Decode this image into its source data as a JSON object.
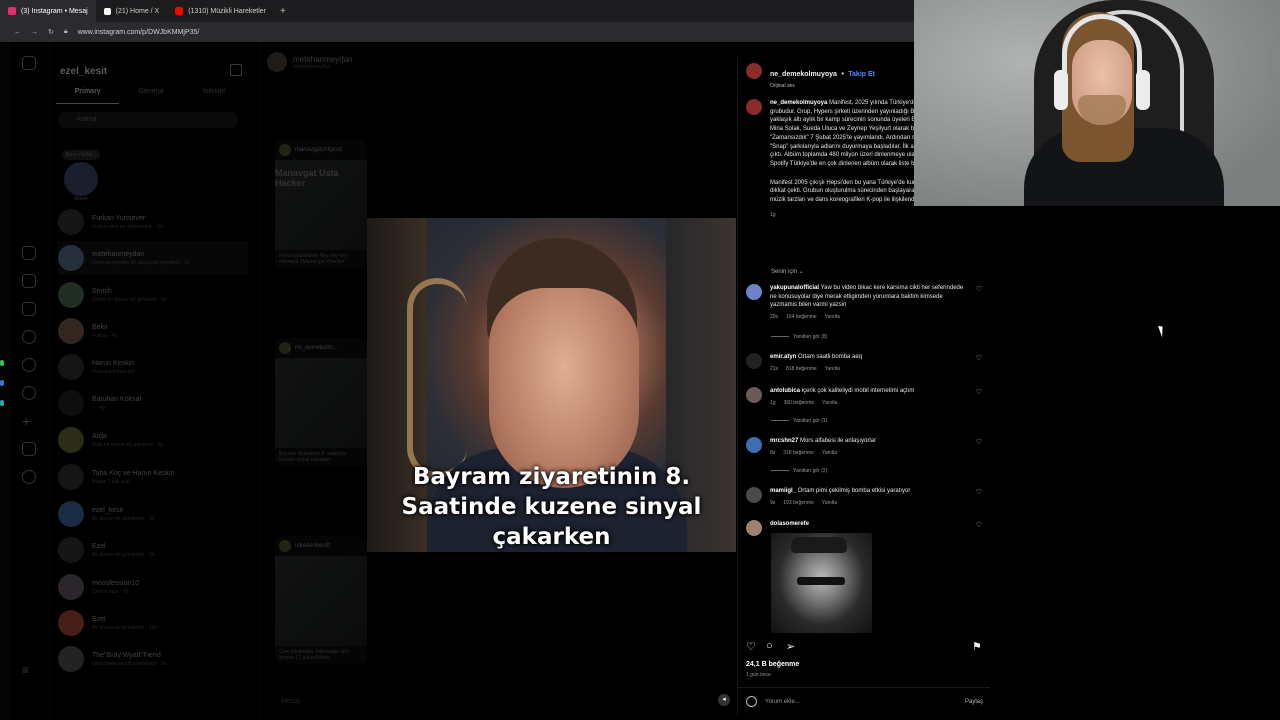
{
  "browser": {
    "tabs": [
      {
        "label": "(3) Instagram • Mesaj",
        "color": "#e1306c"
      },
      {
        "label": "(21) Home / X",
        "color": "#ffffff"
      },
      {
        "label": "(1310) Müzikli Hareketler",
        "color": "#ff0000"
      }
    ],
    "new_tab": "+",
    "url": "www.instagram.com/p/DWJbKMMjP35/"
  },
  "dm": {
    "username": "ezel_kesit",
    "tabs": [
      "Primary",
      "General",
      "İstekler"
    ],
    "search_placeholder": "Arama",
    "note": {
      "bubble": "Bizim Notlar...",
      "label": "Notun"
    },
    "conversations": [
      {
        "name": "Furkan Yurtsever",
        "sub": "Furkan sent an attachment. · 5d"
      },
      {
        "name": "metehanmeydan",
        "sub": "metehanmeydan bir dosya ekl gönderdi · 1s"
      },
      {
        "name": "Semih",
        "sub": "Semih bir dosya eki gönderdi · 3s"
      },
      {
        "name": "Bekir",
        "sub": "Furkan · 4s"
      },
      {
        "name": "Harun Keskin",
        "sub": "Furkan'a mesaj attı"
      },
      {
        "name": "Batuhan Köksal",
        "sub": "7 · 4g"
      },
      {
        "name": "Arda",
        "sub": "Arda bir dosya eki gönderdi · 4g"
      },
      {
        "name": "Taha Koç ve Harun Keskin",
        "sub": "Bugün 2 kişi aktif"
      },
      {
        "name": "ezel_kesit",
        "sub": "Bir dosya eki gönderdin · 1h"
      },
      {
        "name": "Ezel",
        "sub": "Bir dosya eki gönderdin · 1h"
      },
      {
        "name": "meosfession10",
        "sub": "Cem'in burs · 1h"
      },
      {
        "name": "Ezel",
        "sub": "Bir dosya eki gönderdin · 13h"
      },
      {
        "name": "The\"Bray Wyatt\"Fiend",
        "sub": "https://www.reddit.com/r/post · 1h"
      }
    ],
    "chat": {
      "name": "metehanmeydan",
      "handle": "metehanmeydan",
      "cards": [
        {
          "user": "manavgatshitpost",
          "caption": "manavgatshitpost Ney ney ney #Antalya #Manavgat #Hacker"
        },
        {
          "user": "ne_demekolm...",
          "caption": "Bayram ziyaretinin 8. saatinde kuzene sinyal çakarken"
        },
        {
          "user": "ulkedenkesitt",
          "caption": "Cem bilekbokta Teknosada alici iphone 17 güncelleken"
        }
      ],
      "title": "Manavgat Usta Hacker",
      "input_placeholder": "Mesaj..."
    }
  },
  "video": {
    "caption_lines": [
      "Bayram ziyaretinin 8.",
      "Saatinde kuzene sinyal",
      "çakarken"
    ],
    "mute_icon": "speaker-muted-icon"
  },
  "post": {
    "author": "ne_demekolmuyoya",
    "follow": "Takip Et",
    "audio": "Orijinal ses",
    "description_p1": "Manifest, 2025 yılında Türkiye'de kurulan altı üyeli bir kız grubudur. Grup, Hypers şirketi üzerinden yayınladığı BIG 5 Türkiye programı ile yaklaşık altı aylık bir kamp sürecinin sonunda üyeleri Esin Bayram, Lidya Pınar, Mina Solak, Sueda Uluca ve Zeynep Yeşilyurt olarak belirlendi. İlk teklileri \"Zamansızdık\" 7 Şubat 2025'te yayımlandı. Ardından sırayla \"Arıyo\", \"KTS\" ve \"Snap\" şarkılarıyla adlarını duyurmaya başladılar. İlk albümleri \"Manifest\" 2025'te çıktı. Albüm toplamda 480 milyon üzeri dinlenmeye ulaştı. Çıktığı tarihten bu yana Spotify Türkiye'de en çok dinlenen albüm olarak liste başıdır.",
    "description_p2": "Manifest 2005 çıkışlı Hepsi'den bu yana Türkiye'de kurulan ilk kız grubu olarak dikkat çekti. Grubun oluşturulma sürecinden başlayarak sosyal medya içerikleri, müzik tarzları ve dans koreografileri K-pop ile ilişkilendirildi.",
    "time": "1g",
    "for_you": "Senin için ⌄",
    "comments": [
      {
        "user": "yakupunalofficial",
        "text": "Yaw bu video bikac kere karsima cikti her seferindede ne konusuyolar diye merak ettigimden yorumlara baktim kimsede yazmamis bilen varmi yazsin",
        "time": "20s",
        "likes": "164 beğenme",
        "reply": "Yanıtla",
        "replies": "Yanıtları gör (8)"
      },
      {
        "user": "emir.atyn",
        "text": "Ortam saatli bomba aeq",
        "time": "21s",
        "likes": "818 beğenme",
        "reply": "Yanıtla",
        "replies": ""
      },
      {
        "user": "antolubica",
        "text": "içerik çok kaliteliydi mobil internetimi açtım",
        "time": "1g",
        "likes": "360 beğenme",
        "reply": "Yanıtla",
        "replies": "Yanıtları gör (1)"
      },
      {
        "user": "mrcshn27",
        "text": "Mors alfabesi ile anlaşıyorlar",
        "time": "8s",
        "likes": "318 beğenme",
        "reply": "Yanıtla",
        "replies": "Yanıtları gör (2)"
      },
      {
        "user": "mamiigl_",
        "text": "Ortam pimi çekilmiş bomba etkisi yaratıyor",
        "time": "9s",
        "likes": "193 beğenme",
        "reply": "Yanıtla",
        "replies": ""
      },
      {
        "user": "dolasomerefe",
        "text": "",
        "time": "",
        "likes": "",
        "reply": "",
        "replies": ""
      }
    ],
    "like_count": "24,1 B beğenme",
    "posted": "1 gün önce",
    "comment_placeholder": "Yorum ekle...",
    "post_button": "Paylaş"
  }
}
